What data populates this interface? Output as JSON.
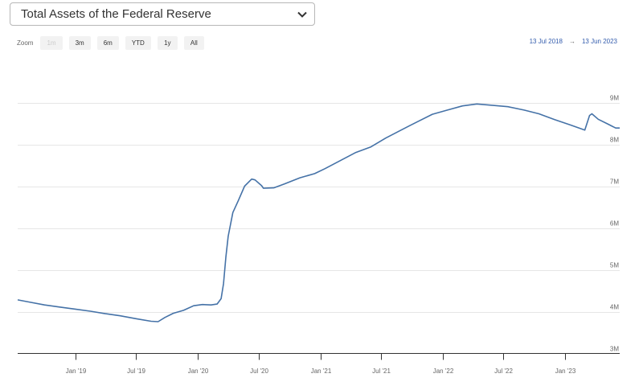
{
  "selector": {
    "selected": "Total Assets of the Federal Reserve",
    "icon": "chevron-down-icon"
  },
  "zoom": {
    "label": "Zoom",
    "buttons": [
      {
        "label": "1m",
        "disabled": true
      },
      {
        "label": "3m",
        "disabled": false
      },
      {
        "label": "6m",
        "disabled": false
      },
      {
        "label": "YTD",
        "disabled": false
      },
      {
        "label": "1y",
        "disabled": false
      },
      {
        "label": "All",
        "disabled": false
      }
    ]
  },
  "range": {
    "from": "13 Jul 2018",
    "arrow": "→",
    "to": "13 Jun 2023"
  },
  "colors": {
    "line": "#4572a7",
    "grid": "#e6e6e6",
    "axis": "#333333",
    "range": "#335cad"
  },
  "chart_data": {
    "type": "line",
    "title": "Total Assets of the Federal Reserve",
    "y_axis_side": "right",
    "ylim": [
      3000000,
      9000000
    ],
    "y_ticks": [
      {
        "value": 3000000,
        "label": "3M"
      },
      {
        "value": 4000000,
        "label": "4M"
      },
      {
        "value": 5000000,
        "label": "5M"
      },
      {
        "value": 6000000,
        "label": "6M"
      },
      {
        "value": 7000000,
        "label": "7M"
      },
      {
        "value": 8000000,
        "label": "8M"
      },
      {
        "value": 9000000,
        "label": "9M"
      }
    ],
    "xlim": [
      "2018-07-13",
      "2023-06-13"
    ],
    "x_ticks": [
      {
        "date": "2019-01-01",
        "label": "Jan '19"
      },
      {
        "date": "2019-07-01",
        "label": "Jul '19"
      },
      {
        "date": "2020-01-01",
        "label": "Jan '20"
      },
      {
        "date": "2020-07-01",
        "label": "Jul '20"
      },
      {
        "date": "2021-01-01",
        "label": "Jan '21"
      },
      {
        "date": "2021-07-01",
        "label": "Jul '21"
      },
      {
        "date": "2022-01-01",
        "label": "Jan '22"
      },
      {
        "date": "2022-07-01",
        "label": "Jul '22"
      },
      {
        "date": "2023-01-01",
        "label": "Jan '23"
      }
    ],
    "grid": true,
    "series": [
      {
        "points": [
          [
            "2018-07-13",
            4280000
          ],
          [
            "2018-08-15",
            4230000
          ],
          [
            "2018-10-01",
            4160000
          ],
          [
            "2018-11-15",
            4110000
          ],
          [
            "2019-01-01",
            4060000
          ],
          [
            "2019-02-15",
            4010000
          ],
          [
            "2019-04-01",
            3950000
          ],
          [
            "2019-05-15",
            3900000
          ],
          [
            "2019-07-01",
            3830000
          ],
          [
            "2019-08-15",
            3770000
          ],
          [
            "2019-09-05",
            3760000
          ],
          [
            "2019-09-25",
            3860000
          ],
          [
            "2019-10-20",
            3960000
          ],
          [
            "2019-11-20",
            4030000
          ],
          [
            "2019-12-20",
            4140000
          ],
          [
            "2020-01-15",
            4170000
          ],
          [
            "2020-02-10",
            4160000
          ],
          [
            "2020-02-28",
            4180000
          ],
          [
            "2020-03-11",
            4310000
          ],
          [
            "2020-03-18",
            4670000
          ],
          [
            "2020-03-25",
            5300000
          ],
          [
            "2020-04-01",
            5800000
          ],
          [
            "2020-04-15",
            6370000
          ],
          [
            "2020-05-01",
            6650000
          ],
          [
            "2020-05-20",
            7000000
          ],
          [
            "2020-06-10",
            7170000
          ],
          [
            "2020-06-20",
            7150000
          ],
          [
            "2020-07-10",
            7010000
          ],
          [
            "2020-07-15",
            6950000
          ],
          [
            "2020-08-15",
            6960000
          ],
          [
            "2020-09-15",
            7050000
          ],
          [
            "2020-11-01",
            7200000
          ],
          [
            "2020-12-15",
            7300000
          ],
          [
            "2021-01-15",
            7420000
          ],
          [
            "2021-03-01",
            7610000
          ],
          [
            "2021-04-15",
            7800000
          ],
          [
            "2021-06-01",
            7940000
          ],
          [
            "2021-07-15",
            8150000
          ],
          [
            "2021-09-01",
            8350000
          ],
          [
            "2021-10-15",
            8530000
          ],
          [
            "2021-12-01",
            8720000
          ],
          [
            "2022-01-15",
            8820000
          ],
          [
            "2022-03-01",
            8920000
          ],
          [
            "2022-04-13",
            8965000
          ],
          [
            "2022-06-01",
            8930000
          ],
          [
            "2022-07-15",
            8900000
          ],
          [
            "2022-09-01",
            8820000
          ],
          [
            "2022-10-15",
            8730000
          ],
          [
            "2022-12-01",
            8590000
          ],
          [
            "2023-01-15",
            8470000
          ],
          [
            "2023-03-01",
            8340000
          ],
          [
            "2023-03-15",
            8690000
          ],
          [
            "2023-03-22",
            8730000
          ],
          [
            "2023-04-10",
            8600000
          ],
          [
            "2023-05-10",
            8480000
          ],
          [
            "2023-06-01",
            8390000
          ],
          [
            "2023-06-13",
            8390000
          ]
        ]
      }
    ]
  }
}
